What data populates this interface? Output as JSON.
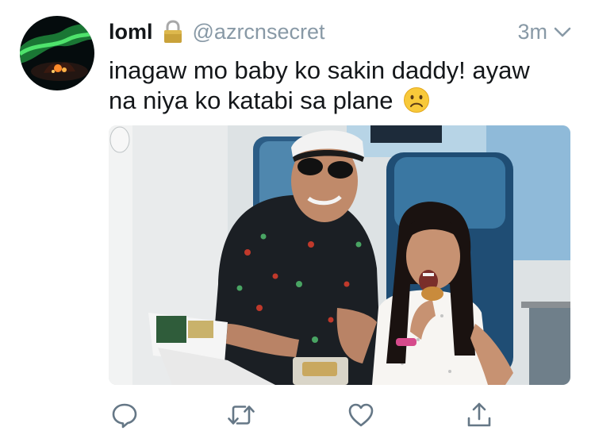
{
  "tweet": {
    "display_name": "loml",
    "handle": "@azrcnsecret",
    "timestamp": "3m",
    "text_line1": "inagaw mo baby ko sakin daddy! ayaw",
    "text_line2": "na niya ko katabi sa plane",
    "emoji": "frowning-face"
  },
  "icons": {
    "lock": "lock-icon",
    "caret": "chevron-down-icon",
    "reply": "reply-icon",
    "retweet": "retweet-icon",
    "like": "heart-icon",
    "share": "share-icon"
  },
  "colors": {
    "text": "#14171a",
    "secondary": "#8899a6",
    "icon": "#657786",
    "lock": "#c9a23a"
  }
}
